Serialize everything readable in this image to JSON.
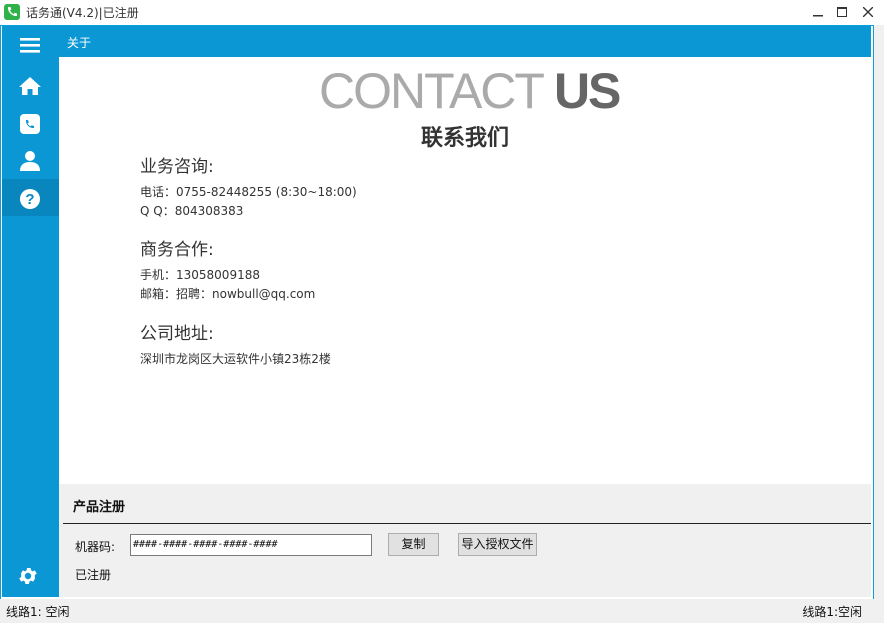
{
  "window": {
    "title": "话务通(V4.2)|已注册"
  },
  "tabbar": {
    "active_tab": "关于"
  },
  "sidebar": {
    "items": [
      {
        "icon": "menu-icon"
      },
      {
        "icon": "home-icon"
      },
      {
        "icon": "phone-icon"
      },
      {
        "icon": "user-icon"
      },
      {
        "icon": "help-icon",
        "active": true
      }
    ],
    "bottom_icon": "gear-icon"
  },
  "about": {
    "hero_thin": "CONTACT ",
    "hero_bold": "US",
    "subtitle": "联系我们",
    "consult": {
      "title": "业务咨询:",
      "phone": "电话：0755-82448255 (8:30~18:00)",
      "qq": "Q Q：804308383"
    },
    "business": {
      "title": "商务合作:",
      "mobile": "手机：13058009188",
      "email": "邮箱：招聘：nowbull@qq.com"
    },
    "address": {
      "title": "公司地址:",
      "line": "深圳市龙岗区大运软件小镇23栋2楼"
    }
  },
  "registration": {
    "title": "产品注册",
    "machine_code_label": "机器码:",
    "machine_code_value": "####-####-####-####-####",
    "copy_button": "复制",
    "import_button": "导入授权文件",
    "status": "已注册"
  },
  "statusbar": {
    "left": "线路1:  空闲",
    "right": "线路1:空闲"
  },
  "colors": {
    "accent": "#0b97d4",
    "accent_active": "#0a86bf",
    "app_icon": "#2fb24a"
  }
}
